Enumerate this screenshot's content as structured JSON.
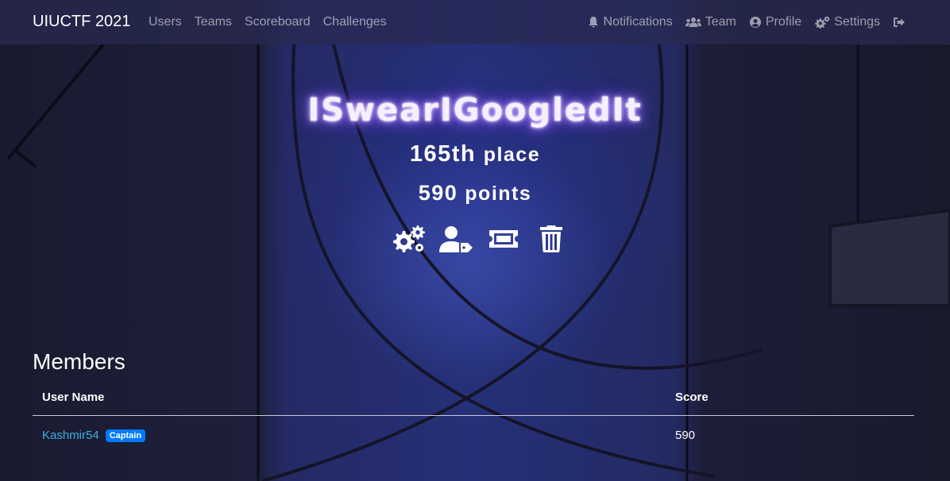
{
  "navbar": {
    "brand": "UIUCTF 2021",
    "left_links": [
      {
        "label": "Users"
      },
      {
        "label": "Teams"
      },
      {
        "label": "Scoreboard"
      },
      {
        "label": "Challenges"
      }
    ],
    "right_links": [
      {
        "label": "Notifications",
        "icon": "bell-icon"
      },
      {
        "label": "Team",
        "icon": "users-icon"
      },
      {
        "label": "Profile",
        "icon": "user-circle-icon"
      },
      {
        "label": "Settings",
        "icon": "cogs-icon"
      }
    ],
    "logout_icon": "sign-out-icon"
  },
  "team": {
    "name": "ISwearIGoogledIt",
    "place_number": "165th",
    "place_word": "place",
    "points_number": "590",
    "points_word": "points"
  },
  "actions": [
    {
      "icon": "cogs-icon"
    },
    {
      "icon": "user-tag-icon"
    },
    {
      "icon": "ticket-icon"
    },
    {
      "icon": "trash-icon"
    }
  ],
  "members": {
    "title": "Members",
    "columns": [
      "User Name",
      "Score"
    ],
    "rows": [
      {
        "name": "Kashmir54",
        "badge": "Captain",
        "score": "590"
      }
    ]
  },
  "colors": {
    "navbar_bg": "#282a50",
    "link": "#3ab0e0",
    "badge": "#007bff",
    "glow": "#9a6bff"
  }
}
